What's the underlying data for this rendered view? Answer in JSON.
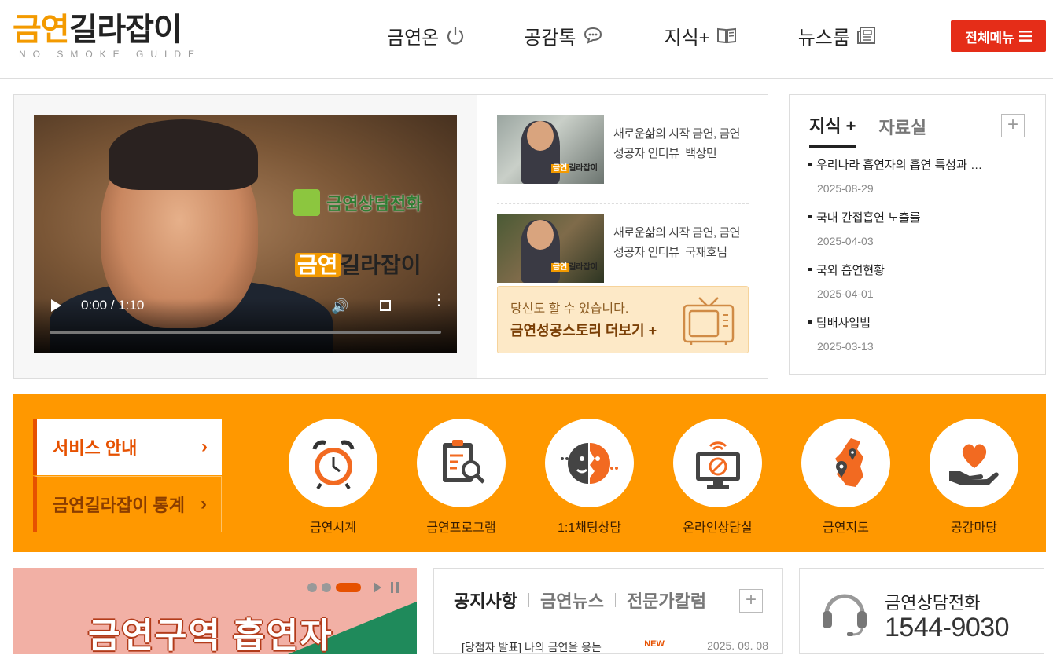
{
  "header": {
    "logo_colored": "금연",
    "logo_dark": "길라잡이",
    "logo_sub": "NO SMOKE GUIDE",
    "nav": [
      {
        "label": "금연온",
        "icon": "power-icon"
      },
      {
        "label": "공감톡",
        "icon": "chat-bubble-icon"
      },
      {
        "label": "지식+",
        "icon": "book-icon"
      },
      {
        "label": "뉴스룸",
        "icon": "newspaper-icon"
      }
    ],
    "all_menu_label": "전체메뉴",
    "all_menu_icon": "hamburger-icon"
  },
  "video": {
    "overlay_line1": "금연상담전화",
    "overlay_logo_colored": "금연",
    "overlay_logo_dark": "길라잡이",
    "time_display": "0:00 / 1:10",
    "list": [
      {
        "title": "새로운삶의 시작 금연, 금연성공자 인터뷰_백상민",
        "thumb_label_colored": "금연",
        "thumb_label_dark": "길라잡이"
      },
      {
        "title": "새로운삶의 시작 금연, 금연성공자 인터뷰_국재호님",
        "thumb_label_colored": "금연",
        "thumb_label_dark": "길라잡이"
      }
    ],
    "banner_line1": "당신도 할 수 있습니다.",
    "banner_line2": "금연성공스토리 더보기 +"
  },
  "knowledge": {
    "tab_active": "지식 +",
    "tab_inactive": "자료실",
    "more_label": "+",
    "items": [
      {
        "title": "우리나라 흡연자의 흡연 특성과 …",
        "date": "2025-08-29"
      },
      {
        "title": "국내 간접흡연 노출률",
        "date": "2025-04-03"
      },
      {
        "title": "국외 흡연현황",
        "date": "2025-04-01"
      },
      {
        "title": "담배사업법",
        "date": "2025-03-13"
      }
    ]
  },
  "services": {
    "service_info_label": "서비스 안내",
    "stats_label": "금연길라잡이 통계",
    "icons": [
      {
        "label": "금연시계",
        "icon": "alarm-clock-icon"
      },
      {
        "label": "금연프로그램",
        "icon": "clipboard-search-icon"
      },
      {
        "label": "1:1채팅상담",
        "icon": "chat-faces-icon"
      },
      {
        "label": "온라인상담실",
        "icon": "monitor-no-smoking-icon"
      },
      {
        "label": "금연지도",
        "icon": "korea-map-icon"
      },
      {
        "label": "공감마당",
        "icon": "heart-hand-icon"
      }
    ]
  },
  "bottom": {
    "banner_text": "금연구역 흡연자",
    "notice_tabs": [
      "공지사항",
      "금연뉴스",
      "전문가칼럼"
    ],
    "notice_more": "+",
    "notice_row_title": "[당첨자 발표] 나의 금연을 응는",
    "notice_row_badge": "NEW",
    "notice_row_date": "2025. 09. 08",
    "call_title": "금연상담전화",
    "call_number": "1544-9030"
  },
  "colors": {
    "accent_orange": "#ff9800",
    "dark_orange": "#e65100",
    "brand_orange": "#f39a00",
    "menu_red": "#e52d18"
  }
}
